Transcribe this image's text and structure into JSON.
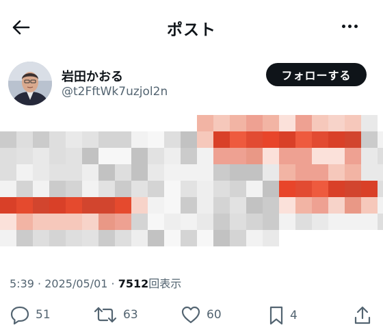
{
  "header": {
    "title": "ポスト",
    "back_icon": "arrow-left-icon",
    "more_icon": "more-horizontal-icon"
  },
  "author": {
    "name": "岩田かおる",
    "handle": "@t2FftWk7uzjol2n",
    "avatar_icon": "profile-photo"
  },
  "follow": {
    "label": "フォローする"
  },
  "tweet": {
    "image_description_icon": "pixelated-mosaic-image",
    "time": "5:39",
    "separator": "·",
    "date": "2025/05/01",
    "views_count": "7512",
    "views_label": "回表示"
  },
  "actions": {
    "reply_count": "51",
    "retweet_count": "63",
    "like_count": "60",
    "bookmark_count": "4"
  },
  "colors": {
    "text_primary": "#0f1419",
    "text_secondary": "#536471",
    "button_dark": "#0f1419",
    "mosaic_red": "#e8452a"
  }
}
